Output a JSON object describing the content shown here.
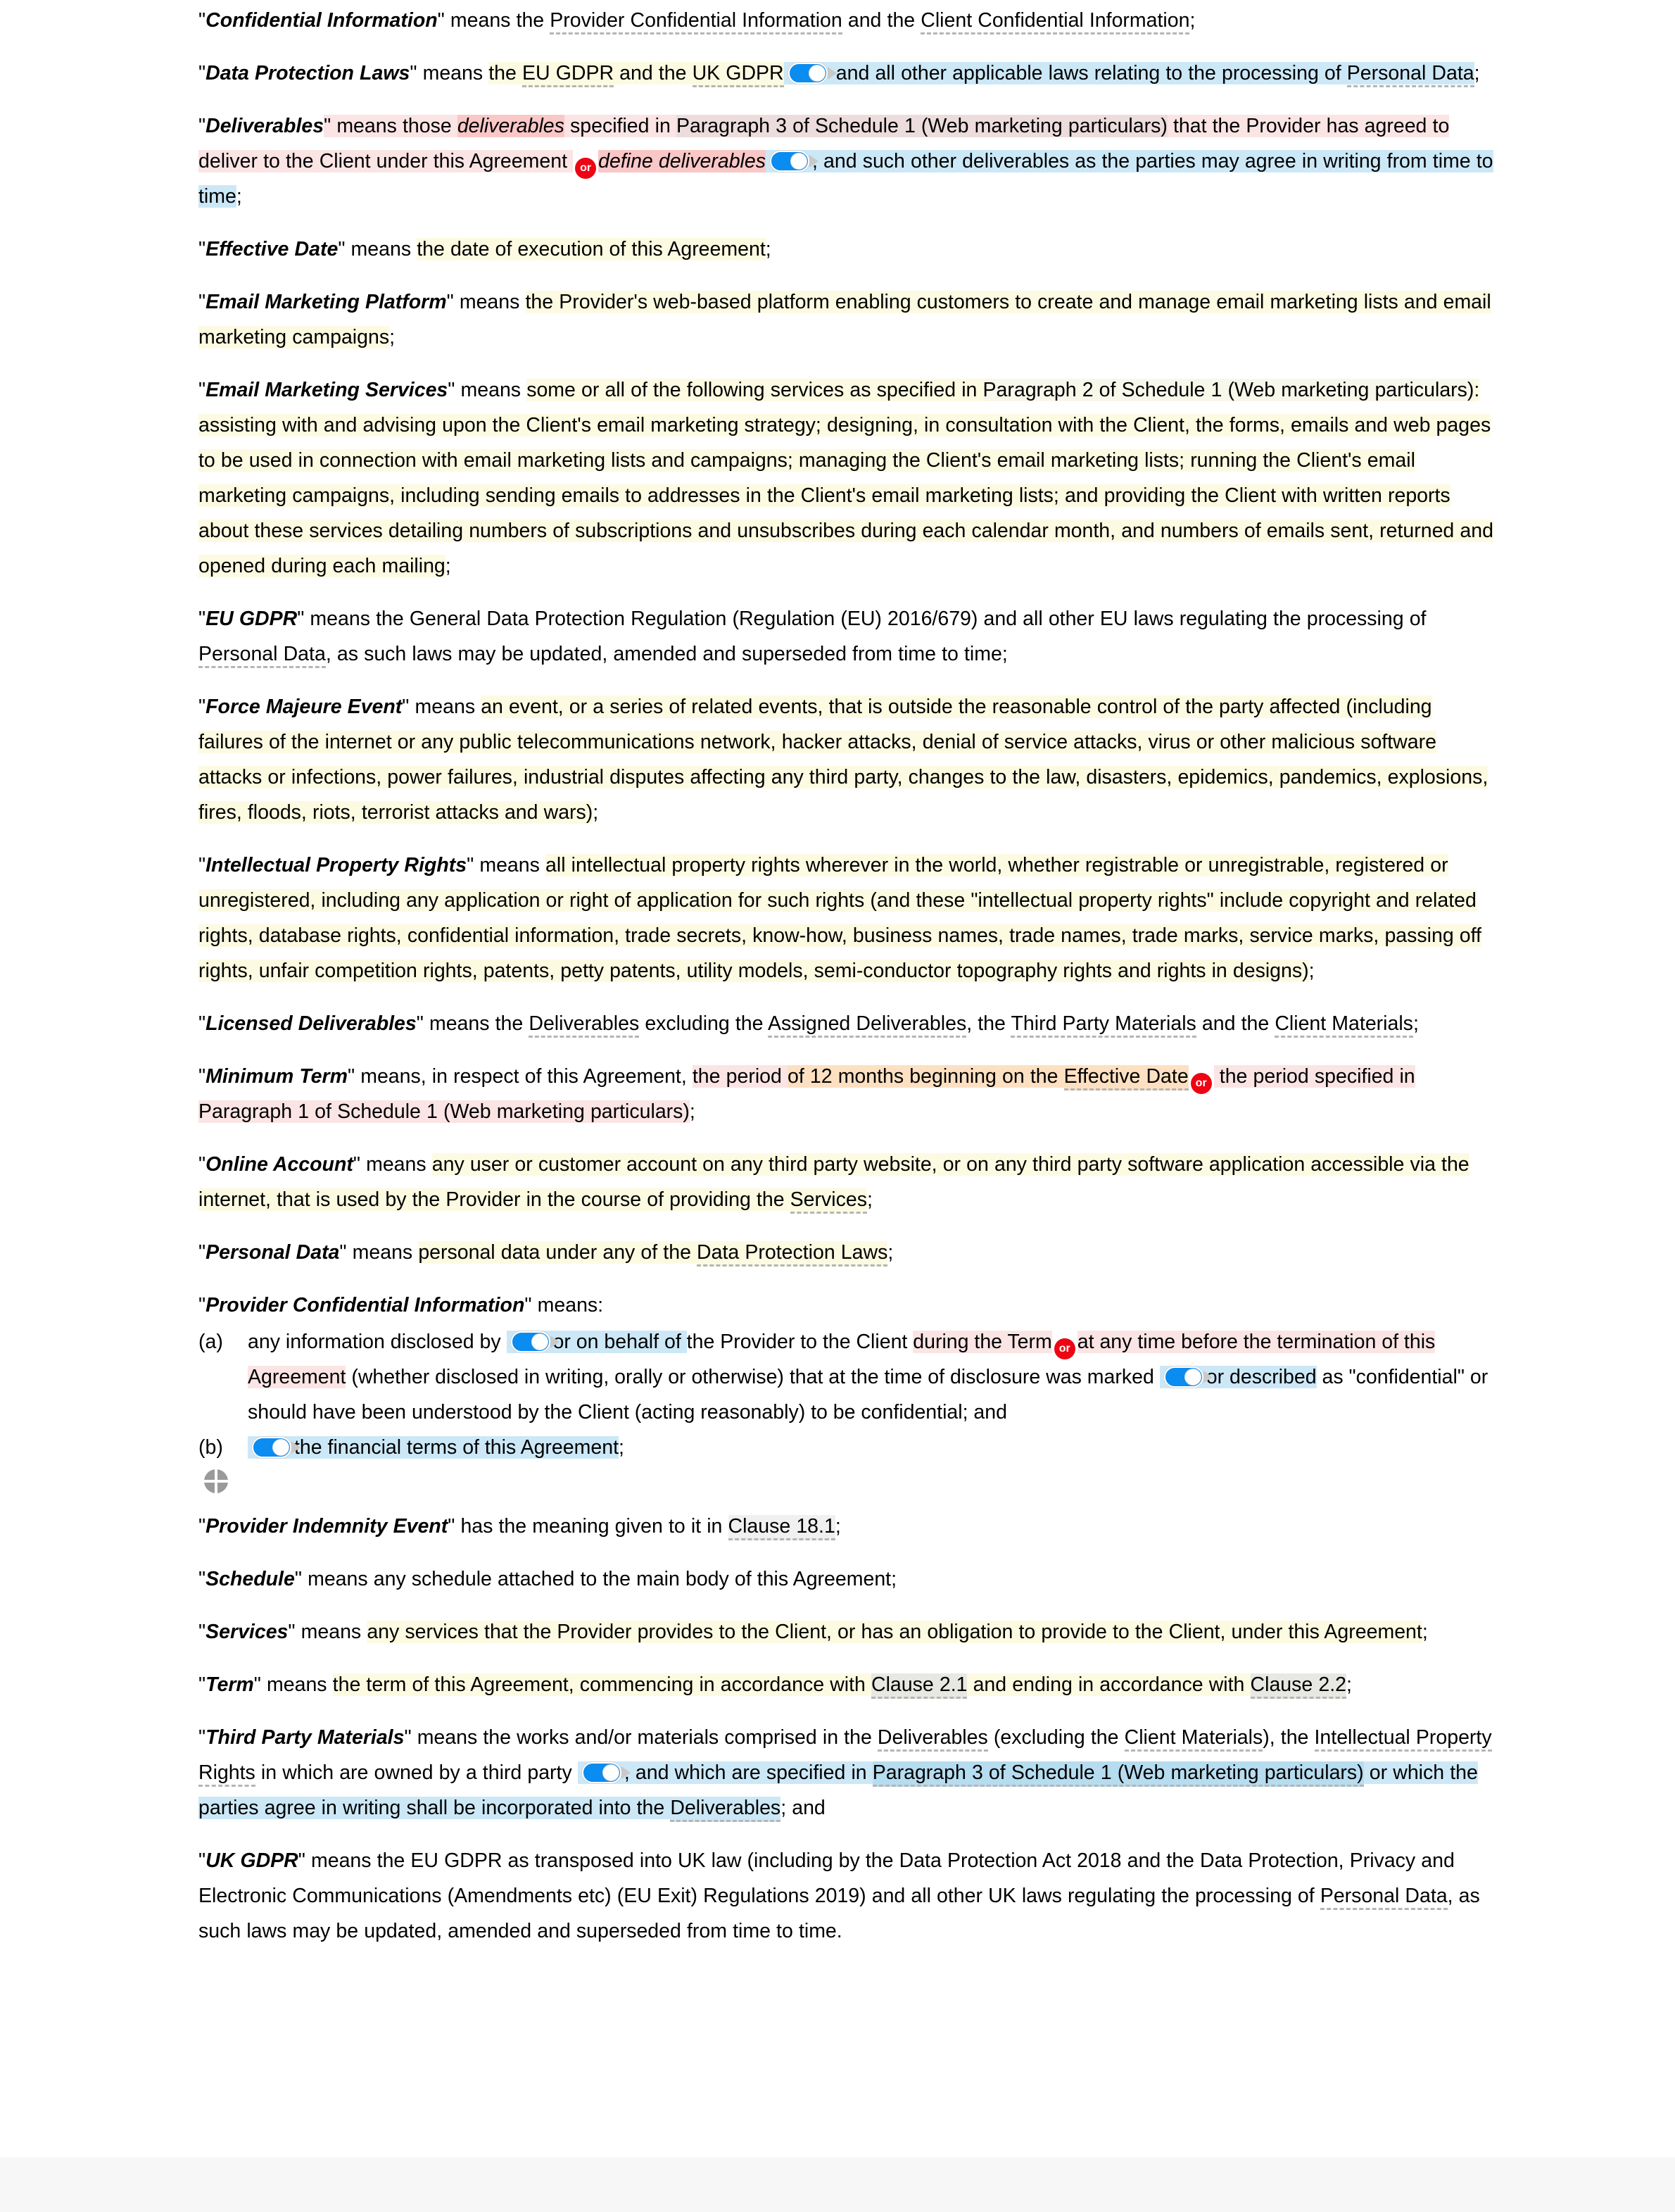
{
  "document": {
    "type": "contract-definitions-editor",
    "colors": {
      "highlight_yellow": "#fcfae1",
      "highlight_blue": "#cce8f7",
      "highlight_blue_dark": "#b6dcef",
      "highlight_pink": "#fbe4e4",
      "highlight_pink_dark": "#fac7c7",
      "highlight_orange": "#fde0c2",
      "highlight_gray": "#f0f0f0",
      "toggle_on": "#0a8cf0",
      "or_badge": "#ee0412",
      "defined_term_underline": "#b5b5b5"
    },
    "controls": {
      "or_badge_label": "or",
      "toggle_state": "on",
      "move_handle_name": "move-handle"
    },
    "definitions": {
      "confidential_information": {
        "term": "Confidential Information",
        "lead": "\" means the ",
        "ref1": "Provider Confidential Information",
        "mid": " and the ",
        "ref2": "Client Confidential Information",
        "end": ";"
      },
      "data_protection_laws": {
        "term": "Data Protection Laws",
        "lead": "\" means ",
        "hl_a": "the ",
        "ref1": "EU GDPR",
        "hl_b": " and the ",
        "ref2": "UK GDPR",
        "hl_c": " and all other applicable laws relating to the processing of ",
        "ref3": "Personal Data",
        "end": ";"
      },
      "deliverables": {
        "term": "Deliverables",
        "lead": "\" means those ",
        "sugg1": "deliverables",
        "mid1": " specified in ",
        "ref1": "Paragraph 3 of Schedule 1 (Web marketing particulars)",
        "mid2": " that the Provider has agreed to deliver to the Client under this Agreement ",
        "sugg2": "define deliverables",
        "mid3": ", and such other deliverables as the parties may agree in writing from time to time",
        "end": ";"
      },
      "effective_date": {
        "term": "Effective Date",
        "lead": "\" means ",
        "hl": "the date of execution of this Agreement",
        "end": ";"
      },
      "email_marketing_platform": {
        "term": "Email Marketing Platform",
        "lead": "\" means ",
        "hl": "the Provider's web-based platform enabling customers to create and manage email marketing lists and email marketing campaigns",
        "end": ";"
      },
      "email_marketing_services": {
        "term": "Email Marketing Services",
        "lead": "\" means ",
        "hl_a": "some or all of the following services as specified in ",
        "ref1": "Paragraph 2 of Schedule 1 (Web marketing particulars)",
        "hl_b": ": assisting with and advising upon the Client's email marketing strategy; designing, in consultation with the Client, the forms, emails and web pages to be used in connection with email marketing lists and campaigns; managing the Client's email marketing lists; running the Client's email marketing campaigns, including sending emails to addresses in the Client's email marketing lists; and providing the Client with written reports about these services detailing numbers of subscriptions and unsubscribes during each calendar month, and numbers of emails sent, returned and opened during each mailing",
        "end": ";"
      },
      "eu_gdpr": {
        "term": "EU GDPR",
        "lead": "\" means the General Data Protection Regulation (Regulation (EU) 2016/679) and all other EU laws regulating the processing of ",
        "ref1": "Personal Data",
        "end": ", as such laws may be updated, amended and superseded from time to time;"
      },
      "force_majeure_event": {
        "term": "Force Majeure Event",
        "lead": "\" means ",
        "hl": "an event, or a series of related events, that is outside the reasonable control of the party affected (including failures of the internet or any public telecommunications network, hacker attacks, denial of service attacks, virus or other malicious software attacks or infections, power failures, industrial disputes affecting any third party, changes to the law, disasters, epidemics, pandemics, explosions, fires, floods, riots, terrorist attacks and wars)",
        "end": ";"
      },
      "intellectual_property_rights": {
        "term": "Intellectual Property Rights",
        "lead": "\" means ",
        "hl": "all intellectual property rights wherever in the world, whether registrable or unregistrable, registered or unregistered, including any application or right of application for such rights (and these \"intellectual property rights\" include copyright and related rights, database rights, confidential information, trade secrets, know-how, business names, trade names, trade marks, service marks, passing off rights, unfair competition rights, patents, petty patents, utility models, semi-conductor topography rights and rights in designs)",
        "end": ";"
      },
      "licensed_deliverables": {
        "term": "Licensed Deliverables",
        "lead": "\" means the ",
        "ref1": "Deliverables",
        "mid1": " excluding the ",
        "ref2": "Assigned Deliverables",
        "mid2": ", the ",
        "ref3": "Third Party Materials",
        "mid3": " and the ",
        "ref4": "Client Materials",
        "end": ";"
      },
      "minimum_term": {
        "term": "Minimum Term",
        "lead": "\" means, in respect of this Agreement, ",
        "hl_a": "the period ",
        "hl_b": "of 12 months beginning on the ",
        "ref1": "Effective Date",
        "hl_c": " the period specified in Paragraph 1 of Schedule 1 (Web marketing particulars)",
        "end": ";"
      },
      "online_account": {
        "term": "Online Account",
        "lead": "\" means ",
        "hl_a": "any user or customer account on any third party website, or on any third party software application accessible via the internet, that is used by the Provider in the course of providing the ",
        "ref1": "Services",
        "end": ";"
      },
      "personal_data": {
        "term": "Personal Data",
        "lead": "\" means ",
        "hl_a": "personal data under any of the ",
        "ref1": "Data Protection Laws",
        "end": ";"
      },
      "provider_confidential_information": {
        "term": "Provider Confidential Information",
        "lead": "\" means:",
        "item_a_marker": "(a)",
        "item_a_t1": "any information disclosed by ",
        "item_a_t2": "or on behalf of ",
        "item_a_t3": "the Provider to the Client ",
        "item_a_t4": "during the Term",
        "item_a_t5": "at any time before the termination of this Agreement",
        "item_a_t6": " (whether disclosed in writing, orally or otherwise) that at the time of disclosure was marked ",
        "item_a_t7": "or described",
        "item_a_t8": " as \"confidential\" or should have been understood by the Client (acting reasonably) to be confidential; and",
        "item_b_marker": "(b)",
        "item_b_t1": "the financial terms of this Agreement",
        "item_b_end": ";"
      },
      "provider_indemnity_event": {
        "term": "Provider Indemnity Event",
        "lead": "\" has the meaning given to it in ",
        "ref1": "Clause 18.1",
        "end": ";"
      },
      "schedule": {
        "term": "Schedule",
        "lead": "\" means any schedule attached to the main body of this Agreement;"
      },
      "services": {
        "term": "Services",
        "lead": "\" means ",
        "hl": "any services that the Provider provides to the Client, or has an obligation to provide to the Client, under this Agreement",
        "end": ";"
      },
      "term_def": {
        "term": "Term",
        "lead": "\" means ",
        "hl_a": "the term of this Agreement, commencing in accordance with ",
        "ref1": "Clause 2.1",
        "hl_b": " and ending in accordance with ",
        "ref2": "Clause 2.2",
        "end": ";"
      },
      "third_party_materials": {
        "term": "Third Party Materials",
        "lead": "\" means the works and/or materials comprised in the ",
        "ref1": "Deliverables",
        "mid1": " (excluding the ",
        "ref2": "Client Materials",
        "mid2": "), the ",
        "ref3": "Intellectual Property Rights",
        "mid3": " in which are owned by a third party ",
        "hl_a": ", and which are specified in ",
        "ref4": "Paragraph 3 of Schedule 1 (Web marketing particulars)",
        "hl_b": " or which the parties agree in writing shall be incorporated into the ",
        "ref5": "Deliverables",
        "end": "; and"
      },
      "uk_gdpr": {
        "term": "UK GDPR",
        "lead": "\" means the EU GDPR as transposed into UK law (including by the Data Protection Act 2018 and the Data Protection, Privacy and Electronic Communications (Amendments etc) (EU Exit) Regulations 2019) and all other UK laws regulating the processing of ",
        "ref1": "Personal Data",
        "end": ", as such laws may be updated, amended and superseded from time to time."
      }
    }
  }
}
